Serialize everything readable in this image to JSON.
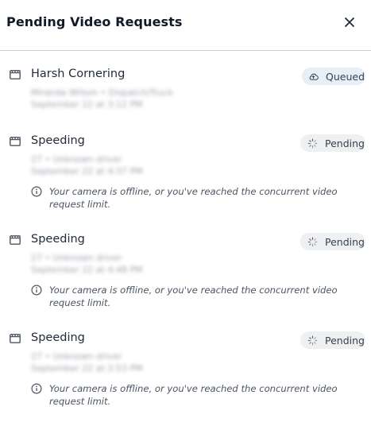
{
  "dialog": {
    "title": "Pending Video Requests",
    "close_icon": "close-icon"
  },
  "requests": [
    {
      "title": "Harsh Cornering",
      "detail_line1": "Miranda Wilson • Dispatch/Truck",
      "detail_line2": "September 22 at 3:12 PM",
      "status": "Queued",
      "status_icon": "cloud-upload-icon"
    },
    {
      "title": "Speeding",
      "detail_line1": "27 • Unknown driver",
      "detail_line2": "September 22 at 4:37 PM",
      "status": "Pending",
      "status_icon": "spinner-icon",
      "warning": "Your camera is offline, or you've reached the concurrent video request limit."
    },
    {
      "title": "Speeding",
      "detail_line1": "27 • Unknown driver",
      "detail_line2": "September 22 at 4:48 PM",
      "status": "Pending",
      "status_icon": "spinner-icon",
      "warning": "Your camera is offline, or you've reached the concurrent video request limit."
    },
    {
      "title": "Speeding",
      "detail_line1": "27 • Unknown driver",
      "detail_line2": "September 22 at 2:53 PM",
      "status": "Pending",
      "status_icon": "spinner-icon",
      "warning": "Your camera is offline, or you've reached the concurrent video request limit."
    }
  ],
  "colors": {
    "queued_badge_bg": "#e6f0f8",
    "pending_badge_bg": "#eef0f2",
    "divider": "#c9ced6"
  }
}
